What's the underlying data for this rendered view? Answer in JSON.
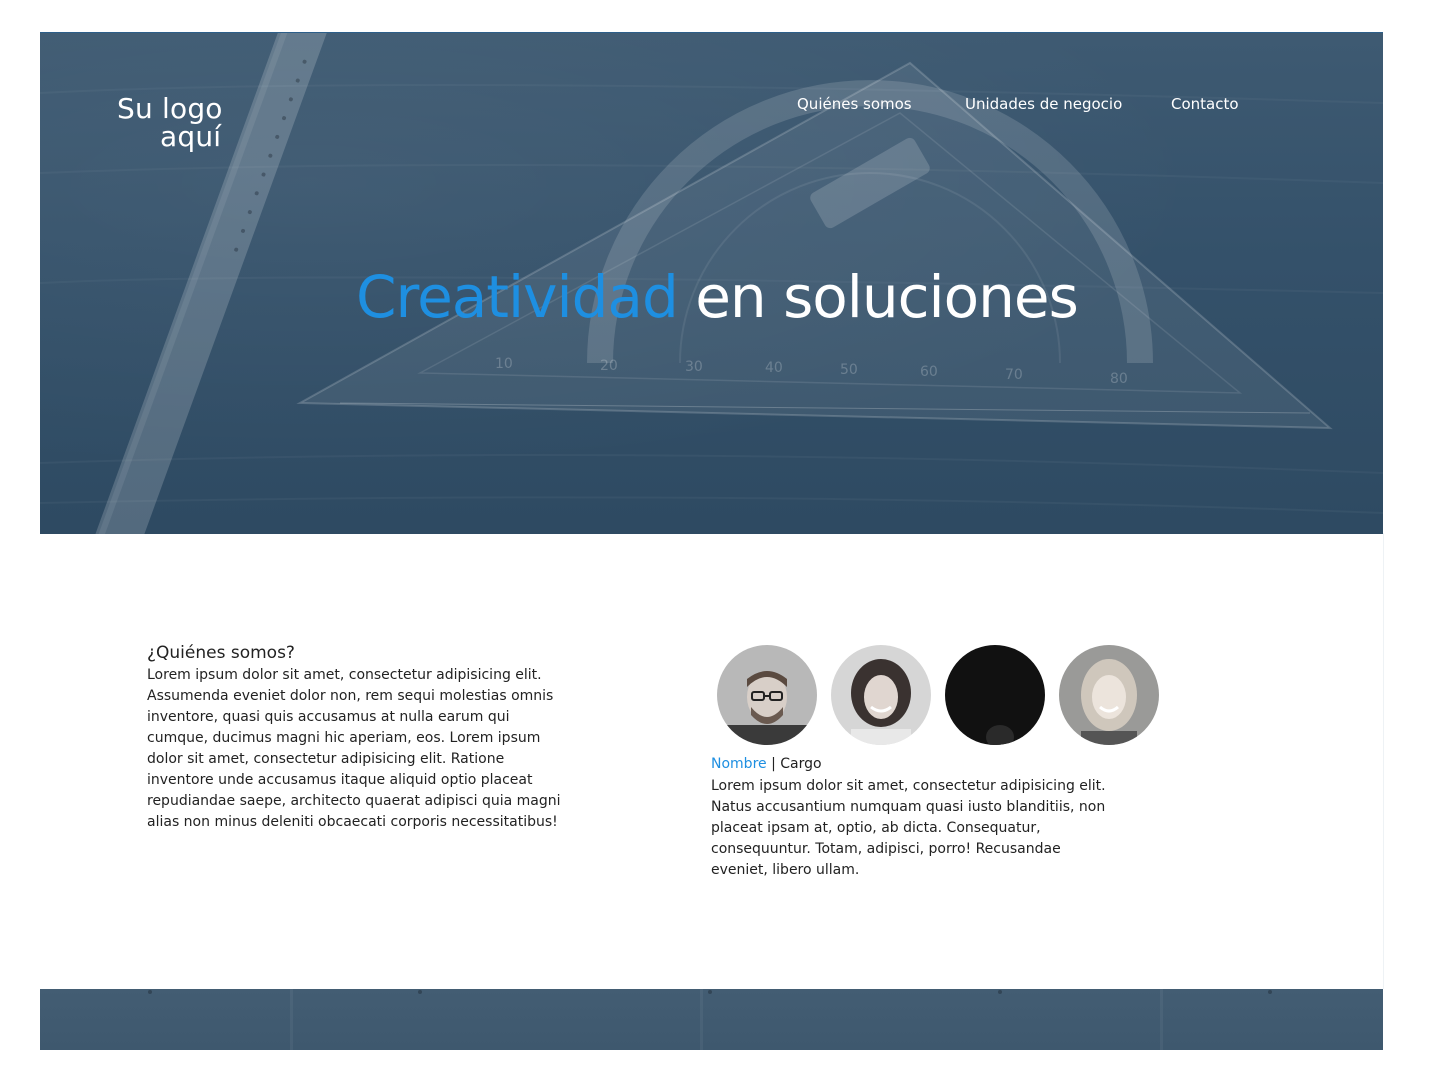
{
  "header": {
    "logo_line1": "Su logo",
    "logo_line2": "aquí",
    "nav": [
      {
        "label": "Quiénes somos"
      },
      {
        "label": "Unidades de negocio"
      },
      {
        "label": "Contacto"
      }
    ]
  },
  "hero": {
    "headline_accent": "Creatividad",
    "headline_rest": " en soluciones"
  },
  "about": {
    "title": "¿Quiénes somos?",
    "text": "Lorem ipsum dolor sit amet, consectetur adipisicing elit. Assumenda eveniet dolor non, rem sequi molestias omnis inventore, quasi quis accusamus at nulla earum qui cumque, ducimus magni hic aperiam, eos. Lorem ipsum dolor sit amet, consectetur adipisicing elit. Ratione inventore unde accusamus itaque aliquid optio placeat repudiandae saepe, architecto quaerat adipisci quia magni alias non minus deleniti obcaecati corporis necessitatibus!"
  },
  "team": {
    "member_name": "Nombre",
    "separator": " | ",
    "member_role": "Cargo",
    "member_text": "Lorem ipsum dolor sit amet, consectetur adipisicing elit. Natus accusantium numquam quasi iusto blanditiis, non placeat ipsam at, optio, ab dicta. Consequatur, consequuntur. Totam, adipisci, porro! Recusandae eveniet, libero ullam."
  },
  "colors": {
    "accent": "#1e8fe1",
    "hero_overlay": "#34516a",
    "footer": "#435d73"
  }
}
